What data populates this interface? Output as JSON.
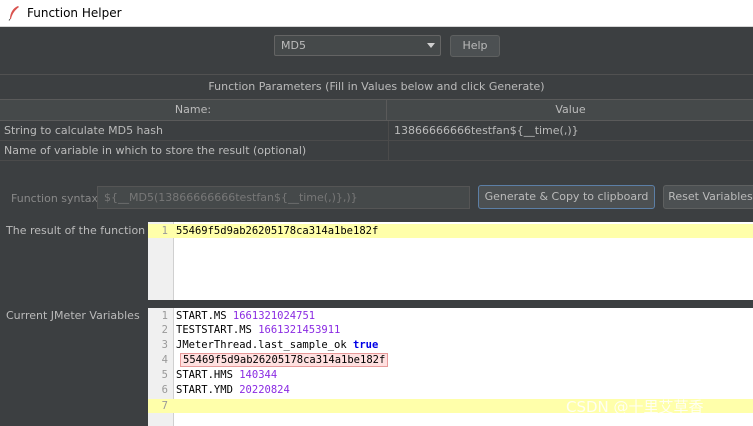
{
  "window": {
    "title": "Function Helper"
  },
  "toolbar": {
    "function_select": "MD5",
    "help_label": "Help"
  },
  "params": {
    "title": "Function Parameters (Fill in Values below and click Generate)",
    "col_name": "Name:",
    "col_value": "Value",
    "rows": [
      {
        "name": "String to calculate MD5 hash",
        "value": "13866666666testfan${__time(,)}"
      },
      {
        "name": "Name of variable in which to store the result (optional)",
        "value": ""
      }
    ]
  },
  "syntax": {
    "label": "Function syntax:",
    "value": "${__MD5(13866666666testfan${__time(,)},)}",
    "generate_label": "Generate & Copy to clipboard",
    "reset_label": "Reset Variables"
  },
  "result": {
    "label": "The result of the function is",
    "lines": [
      {
        "num": "1",
        "text": "55469f5d9ab26205178ca314a1be182f"
      }
    ]
  },
  "vars": {
    "label": "Current JMeter Variables",
    "lines": [
      {
        "num": "1",
        "key": "START.MS",
        "val": "1661321024751"
      },
      {
        "num": "2",
        "key": "TESTSTART.MS",
        "val": "1661321453911"
      },
      {
        "num": "3",
        "key": "JMeterThread.last_sample_ok",
        "val": "true"
      },
      {
        "num": "4",
        "key": "",
        "val": "55469f5d9ab26205178ca314a1be182f"
      },
      {
        "num": "5",
        "key": "START.HMS",
        "val": "140344"
      },
      {
        "num": "6",
        "key": "START.YMD",
        "val": "20220824"
      },
      {
        "num": "7",
        "key": "",
        "val": ""
      }
    ]
  },
  "watermark": "CSDN @十里艾草香"
}
